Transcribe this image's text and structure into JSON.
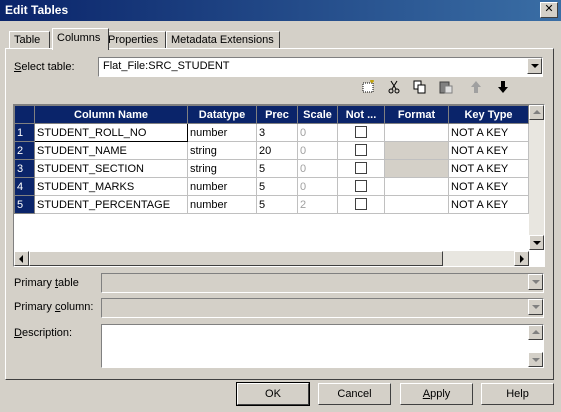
{
  "window": {
    "title": "Edit Tables",
    "close_symbol": "✕"
  },
  "tabs": [
    {
      "label": "Table",
      "active": false
    },
    {
      "label": "Columns",
      "active": true
    },
    {
      "label": "Properties",
      "active": false
    },
    {
      "label": "Metadata Extensions",
      "active": false
    }
  ],
  "select_table": {
    "label_accel": "S",
    "label_rest": "elect table:",
    "value": "Flat_File:SRC_STUDENT"
  },
  "toolbar": {
    "new_icon": "new-column-icon",
    "cut_icon": "cut-icon",
    "copy_icon": "copy-icon",
    "paste_icon": "paste-icon",
    "up_icon": "move-up-icon",
    "down_icon": "move-down-icon"
  },
  "grid": {
    "headers": [
      "Column Name",
      "Datatype",
      "Prec",
      "Scale",
      "Not ...",
      "Format",
      "Key Type"
    ],
    "rows": [
      {
        "num": "1",
        "name": "STUDENT_ROLL_NO",
        "type": "number",
        "prec": "3",
        "scale": "0",
        "key": "NOT A KEY",
        "format_grey": false
      },
      {
        "num": "2",
        "name": "STUDENT_NAME",
        "type": "string",
        "prec": "20",
        "scale": "0",
        "key": "NOT A KEY",
        "format_grey": true
      },
      {
        "num": "3",
        "name": "STUDENT_SECTION",
        "type": "string",
        "prec": "5",
        "scale": "0",
        "key": "NOT A KEY",
        "format_grey": true
      },
      {
        "num": "4",
        "name": "STUDENT_MARKS",
        "type": "number",
        "prec": "5",
        "scale": "0",
        "key": "NOT A KEY",
        "format_grey": false
      },
      {
        "num": "5",
        "name": "STUDENT_PERCENTAGE",
        "type": "number",
        "prec": "5",
        "scale": "2",
        "key": "NOT A KEY",
        "format_grey": false
      }
    ]
  },
  "primary_table": {
    "label_pre": "Primary ",
    "label_accel": "t",
    "label_rest": "able"
  },
  "primary_column": {
    "label_pre": "Primary ",
    "label_accel": "c",
    "label_rest": "olumn:"
  },
  "description": {
    "label_accel": "D",
    "label_rest": "escription:"
  },
  "buttons": {
    "ok": "OK",
    "cancel": "Cancel",
    "apply_accel": "A",
    "apply_rest": "pply",
    "help": "Help"
  }
}
